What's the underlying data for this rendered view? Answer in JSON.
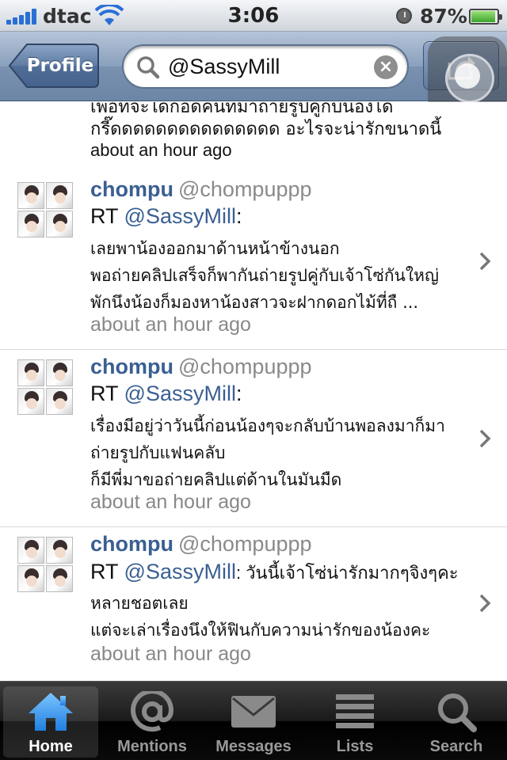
{
  "status_bar": {
    "carrier": "dtac",
    "time": "3:06",
    "battery": "87%",
    "battery_level": 0.87
  },
  "nav": {
    "back_label": "Profile",
    "search_value": "@SassyMill"
  },
  "partial_tweet": {
    "line1": "เพื่อที่จะได้กอดคนที่มาถ่ายรูปคู่กับน้องได้",
    "line2": "กรี๊ดดดดดดดดดดดดดดด อะไรจะน่ารักขนาดนี้",
    "time": "about an hour ago"
  },
  "tweets": [
    {
      "name": "chompu",
      "handle": "@chompuppp",
      "rt": "RT ",
      "mention": "@SassyMill",
      "colon": ":",
      "lines": [
        "เลยพาน้องออกมาด้านหน้าข้างนอก",
        "พอถ่ายคลิปเสร็จก็พากันถ่ายรูปคู่กับเจ้าโซ่กันใหญ่",
        "พักนึงน้องก็มองหาน้องสาวจะฝากดอกไม้ที่ถื ..."
      ],
      "time": "about an hour ago"
    },
    {
      "name": "chompu",
      "handle": "@chompuppp",
      "rt": "RT ",
      "mention": "@SassyMill",
      "colon": ":",
      "lines": [
        "เรื่องมีอยู่ว่าวันนี้ก่อนน้องๆจะกลับบ้านพอลงมาก็มา",
        "ถ่ายรูปกับแฟนคลับ",
        "ก็มีพี่มาขอถ่ายคลิปแต่ด้านในมันมืด"
      ],
      "time": "about an hour ago"
    },
    {
      "name": "chompu",
      "handle": "@chompuppp",
      "rt": "RT ",
      "mention": "@SassyMill",
      "colon": ": วันนี้เจ้าโซ่น่ารักมากๆจิงๆคะ",
      "lines": [
        "หลายชอตเลย",
        "แต่จะเล่าเรื่องนึงให้ฟินกับความน่ารักของน้องคะ"
      ],
      "time": "about an hour ago"
    }
  ],
  "tabs": [
    {
      "label": "Home",
      "icon": "home-icon",
      "active": true
    },
    {
      "label": "Mentions",
      "icon": "at-icon",
      "active": false
    },
    {
      "label": "Messages",
      "icon": "envelope-icon",
      "active": false
    },
    {
      "label": "Lists",
      "icon": "list-icon",
      "active": false
    },
    {
      "label": "Search",
      "icon": "search-icon",
      "active": false
    }
  ],
  "colors": {
    "link": "#3a5f92",
    "time": "#888888",
    "nav_bar": "#7a91b0",
    "tab_active_icon": "#3b9cf0"
  }
}
